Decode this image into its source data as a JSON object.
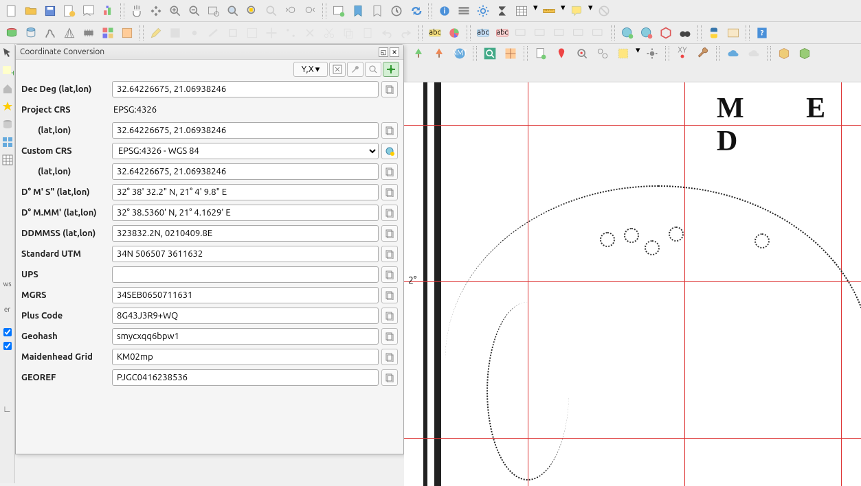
{
  "panel": {
    "title": "Coordinate Conversion",
    "order_button": "Y,X",
    "rows": {
      "decdeg_label": "Dec Deg (lat,lon)",
      "decdeg_value": "32.64226675, 21.06938246",
      "projectcrs_label": "Project CRS",
      "projectcrs_value": "EPSG:4326",
      "projectcrs_latlon_label": "(lat,lon)",
      "projectcrs_latlon_value": "32.64226675, 21.06938246",
      "customcrs_label": "Custom CRS",
      "customcrs_value": "EPSG:4326 - WGS 84",
      "customcrs_latlon_label": "(lat,lon)",
      "customcrs_latlon_value": "32.64226675, 21.06938246",
      "dms_label": "D° M' S\" (lat,lon)",
      "dms_value": "32° 38' 32.2\" N, 21° 4' 9.8\" E",
      "dmm_label": "D° M.MM' (lat,lon)",
      "dmm_value": "32° 38.5360' N, 21° 4.1629' E",
      "ddmmss_label": "DDMMSS (lat,lon)",
      "ddmmss_value": "323832.2N, 0210409.8E",
      "utm_label": "Standard UTM",
      "utm_value": "34N 506507 3611632",
      "ups_label": "UPS",
      "ups_value": "",
      "mgrs_label": "MGRS",
      "mgrs_value": "34SEB0650711631",
      "pluscode_label": "Plus Code",
      "pluscode_value": "8G43J3R9+WQ",
      "geohash_label": "Geohash",
      "geohash_value": "smycxqq6bpw1",
      "maidenhead_label": "Maidenhead Grid",
      "maidenhead_value": "KM02mp",
      "georef_label": "GEOREF",
      "georef_value": "PJGC0416238536"
    }
  },
  "map": {
    "title_letters": "M  E  D",
    "degree_label": "2°"
  },
  "left_rail": {
    "text1": "ws",
    "text2": "er"
  }
}
